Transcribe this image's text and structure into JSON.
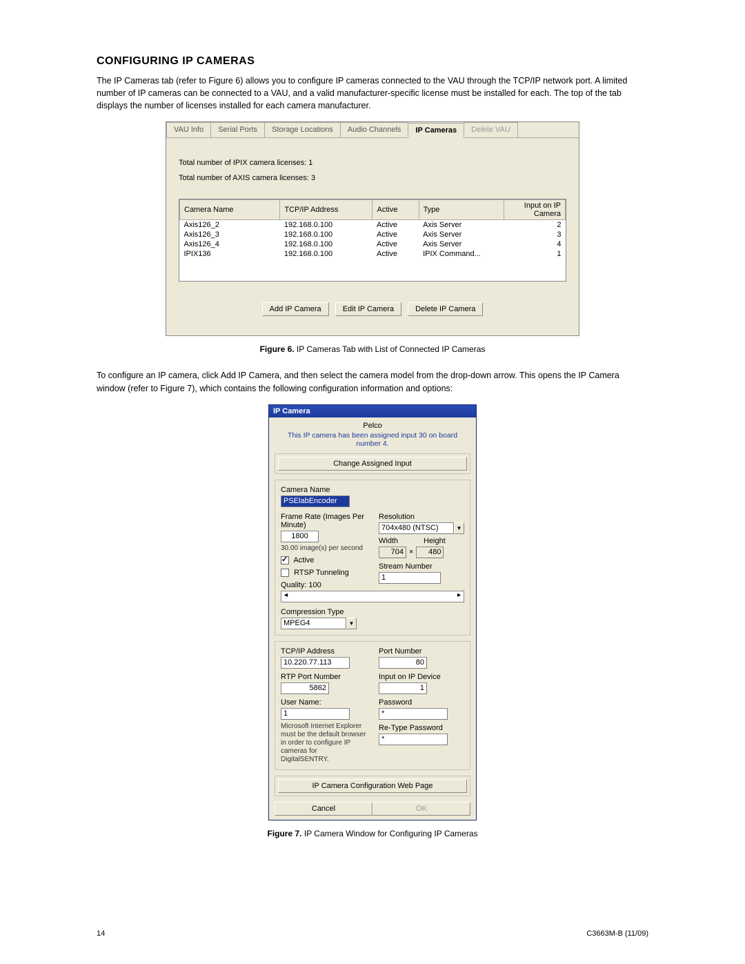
{
  "heading": "CONFIGURING IP CAMERAS",
  "intro": "The IP Cameras tab (refer to Figure 6) allows you to configure IP cameras connected to the VAU through the TCP/IP network port. A limited number of IP cameras can be connected to a VAU, and a valid manufacturer-specific license must be installed for each. The top of the tab displays the number of licenses installed for each camera manufacturer.",
  "midpara": "To configure an IP camera, click Add IP Camera, and then select the camera model from the drop-down arrow. This opens the IP Camera window (refer to Figure 7), which contains the following configuration information and options:",
  "fig6": {
    "tabs": [
      "VAU Info",
      "Serial Ports",
      "Storage Locations",
      "Audio Channels",
      "IP Cameras",
      "Delete VAU"
    ],
    "active_tab_index": 4,
    "disabled_tab_index": 5,
    "lic1": "Total number of IPIX camera licenses: 1",
    "lic2": "Total number of AXIS camera licenses: 3",
    "cols": [
      "Camera Name",
      "TCP/IP Address",
      "Active",
      "Type",
      "Input on IP Camera"
    ],
    "rows": [
      {
        "name": "Axis126_2",
        "ip": "192.168.0.100",
        "active": "Active",
        "type": "Axis Server",
        "input": "2"
      },
      {
        "name": "Axis126_3",
        "ip": "192.168.0.100",
        "active": "Active",
        "type": "Axis Server",
        "input": "3"
      },
      {
        "name": "Axis126_4",
        "ip": "192.168.0.100",
        "active": "Active",
        "type": "Axis Server",
        "input": "4"
      },
      {
        "name": "IPIX136",
        "ip": "192.168.0.100",
        "active": "Active",
        "type": "IPIX Command...",
        "input": "1"
      }
    ],
    "buttons": {
      "add": "Add IP Camera",
      "edit": "Edit IP Camera",
      "del": "Delete IP Camera"
    },
    "caption_b": "Figure 6.",
    "caption": " IP Cameras Tab with List of Connected IP Cameras"
  },
  "fig7": {
    "title": "IP Camera",
    "brand": "Pelco",
    "assigned_text": "This IP camera has been assigned input 30 on board number 4.",
    "change_btn": "Change Assigned Input",
    "labels": {
      "camera_name": "Camera Name",
      "frame_rate": "Frame Rate (Images Per Minute)",
      "images_per_second": "30.00 image(s) per second",
      "active": "Active",
      "rtsp": "RTSP Tunneling",
      "quality": "Quality: 100",
      "compression": "Compression Type",
      "resolution": "Resolution",
      "width": "Width",
      "height": "Height",
      "stream": "Stream Number",
      "tcpip": "TCP/IP Address",
      "port": "Port Number",
      "rtp": "RTP Port Number",
      "input_device": "Input on IP Device",
      "user": "User Name:",
      "pass": "Password",
      "repass": "Re-Type Password",
      "note": "Microsoft Internet Explorer must be the default browser in order to configure IP cameras for DigitalSENTRY.",
      "webpage_btn": "IP Camera Configuration Web Page",
      "cancel": "Cancel",
      "ok": "OK"
    },
    "values": {
      "camera_name": "PSElabEncoder",
      "frame_rate": "1800",
      "compression": "MPEG4",
      "resolution": "704x480 (NTSC)",
      "width": "704",
      "height": "480",
      "stream": "1",
      "tcpip": "10.220.77.113",
      "port": "80",
      "rtp": "5862",
      "input_device": "1",
      "user": "1",
      "pass": "*",
      "repass": "*"
    },
    "caption_b": "Figure 7.",
    "caption": " IP Camera Window for Configuring IP Cameras"
  },
  "footer": {
    "page": "14",
    "doc": "C3663M-B (11/09)"
  }
}
